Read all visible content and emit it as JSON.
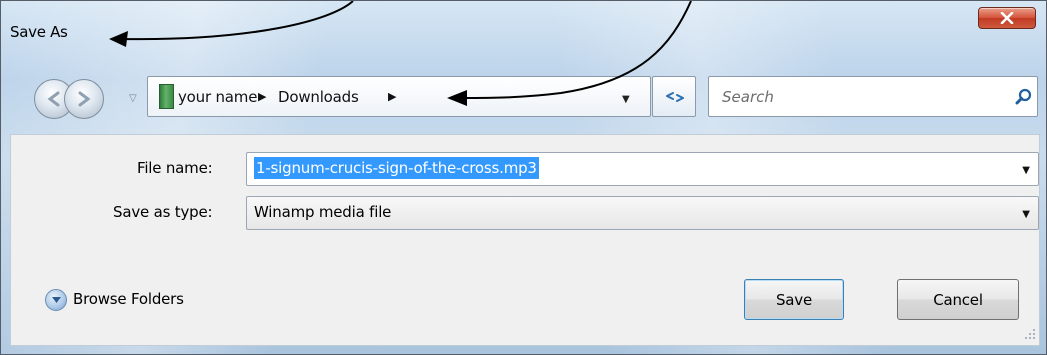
{
  "window": {
    "title": "Save As"
  },
  "nav": {
    "breadcrumbs": [
      "your name",
      "Downloads"
    ],
    "search_placeholder": "Search"
  },
  "form": {
    "file_name_label": "File name:",
    "file_name_value": "1-signum-crucis-sign-of-the-cross.mp3",
    "save_type_label": "Save as type:",
    "save_type_value": "Winamp media file"
  },
  "footer": {
    "browse_label": "Browse Folders",
    "save_label": "Save",
    "cancel_label": "Cancel"
  },
  "icons": {
    "close": "close-icon",
    "back": "back-arrow-icon",
    "forward": "forward-arrow-icon",
    "folder": "folder-icon",
    "refresh": "refresh-icon",
    "search": "search-icon",
    "browse": "chevron-down-icon"
  },
  "colors": {
    "selection": "#3399ff",
    "close_button": "#c13a22",
    "frame": "#bcd3ea"
  }
}
